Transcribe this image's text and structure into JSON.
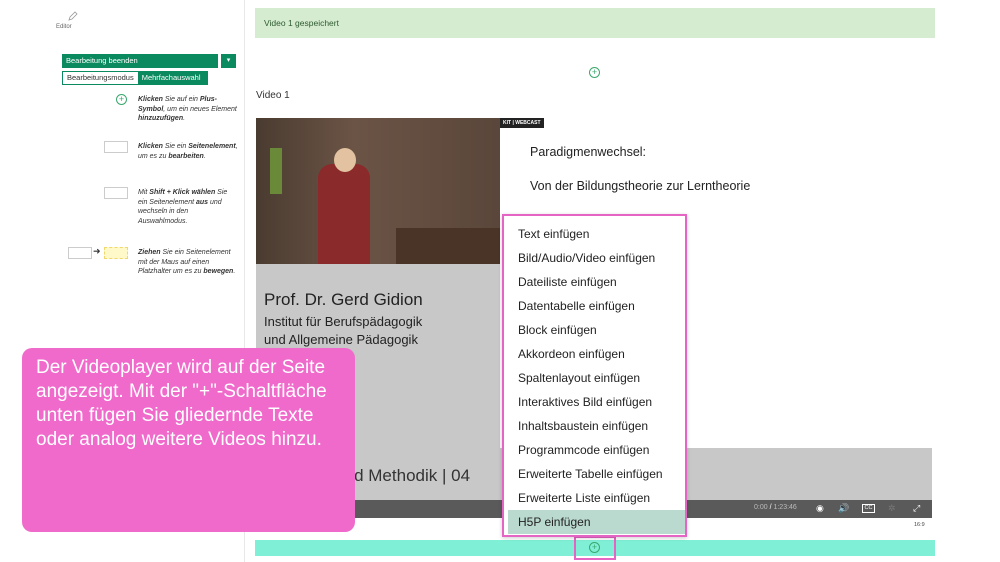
{
  "sidebar": {
    "editor_label": "Editor",
    "end_button": "Bearbeitung beenden",
    "dropdown_glyph": "▾",
    "modes": [
      "Bearbeitungsmodus",
      "Mehrfachauswahl"
    ],
    "hints": [
      {
        "pre": "",
        "bold": "Klicken",
        "mid1": " Sie auf ein ",
        "bold2": "Plus-Symbol",
        "mid2": ", um ein neues Element ",
        "bold3": "hinzuzufügen",
        "post": "."
      },
      {
        "pre": "",
        "bold": "Klicken",
        "mid1": " Sie ein ",
        "bold2": "Seitenelement",
        "mid2": ", um es zu ",
        "bold3": "bearbeiten",
        "post": "."
      },
      {
        "pre": "Mit ",
        "bold": "Shift + Klick wählen",
        "mid1": " Sie ein Seitenelement ",
        "bold2": "aus",
        "mid2": " und wechseln in den Auswahlmodus.",
        "bold3": "",
        "post": ""
      },
      {
        "pre": "",
        "bold": "Ziehen",
        "mid1": " Sie ein Seitenelement mit der Maus auf einen Platzhalter um es zu ",
        "bold2": "bewegen",
        "mid2": ".",
        "bold3": "",
        "post": ""
      }
    ]
  },
  "main": {
    "saved_message": "Video 1 gespeichert",
    "video_title": "Video 1",
    "plus_glyph": "+"
  },
  "video": {
    "logo": "KIT | WEBCAST",
    "slide_title": "Paradigmenwechsel:",
    "slide_subtitle": "Von der Bildungstheorie zur Lerntheorie",
    "professor": "Prof. Dr. Gerd Gidion",
    "institute_1": "Institut für Berufspädagogik",
    "institute_2": "und Allgemeine Pädagogik",
    "course": "Didaktik und Methodik | 04",
    "time_current": "0:00",
    "time_total": "1:23:46",
    "cc_label": "CC",
    "aspect": "16:9"
  },
  "menu": {
    "items": [
      "Text einfügen",
      "Bild/Audio/Video einfügen",
      "Dateiliste einfügen",
      "Datentabelle einfügen",
      "Block einfügen",
      "Akkordeon einfügen",
      "Spaltenlayout einfügen",
      "Interaktives Bild einfügen",
      "Inhaltsbaustein einfügen",
      "Programmcode einfügen",
      "Erweiterte Tabelle einfügen",
      "Erweiterte Liste einfügen",
      "H5P einfügen"
    ],
    "active_index": 12
  },
  "callout": {
    "text": "Der Videoplayer wird auf der Seite angezeigt. Mit der \"+\"-Schaltfläche unten fügen Sie gliedernde Texte oder analog weitere Videos hinzu."
  },
  "colors": {
    "brand_green": "#0b8a5f",
    "saved_bg": "#d5ecd1",
    "highlight_pink": "#e565c4",
    "callout_pink": "#f06acb",
    "teal": "#7ff0d6"
  }
}
